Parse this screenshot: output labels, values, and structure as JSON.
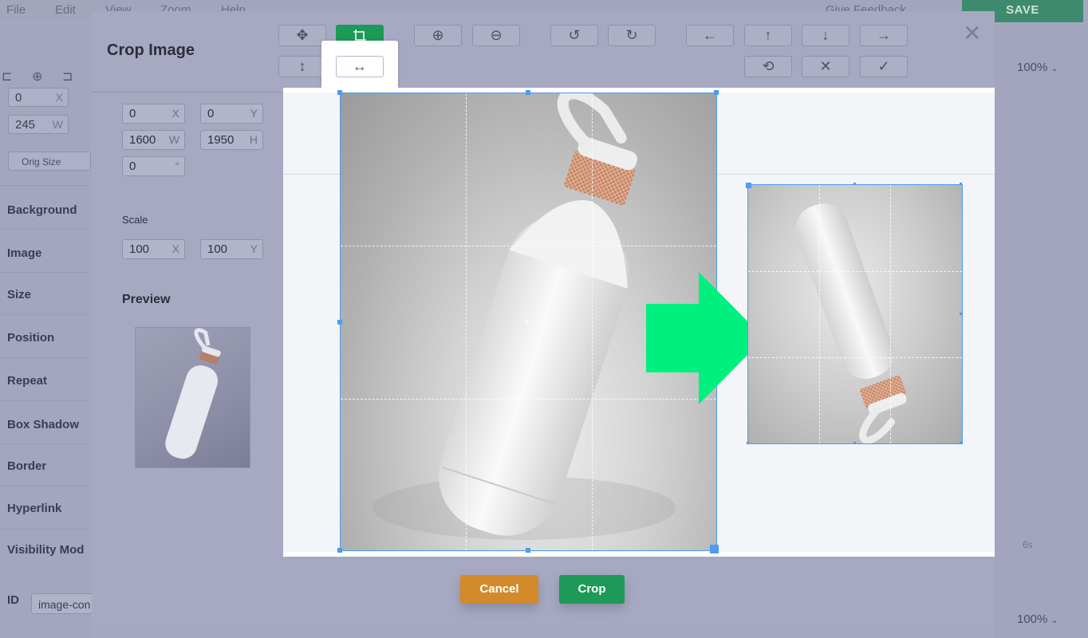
{
  "app": {
    "menu": [
      "File",
      "Edit",
      "View",
      "Zoom",
      "Help"
    ],
    "give_feedback": "Give Feedback",
    "save_label": "SAVE",
    "left_panel": {
      "x_value": "0",
      "x_unit": "X",
      "w_value": "245",
      "w_unit": "W",
      "orig_size_label": "Orig Size",
      "sections": [
        "Background",
        "Image",
        "Size",
        "Position",
        "Repeat",
        "Box Shadow",
        "Border",
        "Hyperlink",
        "Visibility Mod"
      ],
      "id_label": "ID",
      "id_value": "image-con"
    },
    "right_panel": {
      "zoom_top": "100%",
      "zoom_bottom": "100%",
      "timeline_label": "6s"
    }
  },
  "modal": {
    "title": "Crop Image",
    "close_symbol": "✕",
    "toolbar": {
      "move": "✥",
      "crop": "⛶",
      "zoom_in": "⊕",
      "zoom_out": "⊖",
      "rotate_left": "↺",
      "rotate_right": "↻",
      "move_left": "←",
      "move_up": "↑",
      "move_down": "↓",
      "move_right": "→",
      "flip_vertical": "↕",
      "flip_horizontal": "↔",
      "reset": "⟲",
      "clear": "✕",
      "confirm": "✓"
    },
    "fields": {
      "x": {
        "value": "0",
        "unit": "X"
      },
      "y": {
        "value": "0",
        "unit": "Y"
      },
      "w": {
        "value": "1600",
        "unit": "W"
      },
      "h": {
        "value": "1950",
        "unit": "H"
      },
      "rotate": {
        "value": "0",
        "unit": "°"
      },
      "scale_label": "Scale",
      "scale_x": {
        "value": "100",
        "unit": "X"
      },
      "scale_y": {
        "value": "100",
        "unit": "Y"
      }
    },
    "preview_label": "Preview",
    "cancel_label": "Cancel",
    "crop_label": "Crop",
    "colors": {
      "accent_green": "#1d9a57",
      "cancel_orange": "#d28a2b",
      "arrow_green": "#00f07f",
      "selection_blue": "#4c9cf0"
    }
  }
}
